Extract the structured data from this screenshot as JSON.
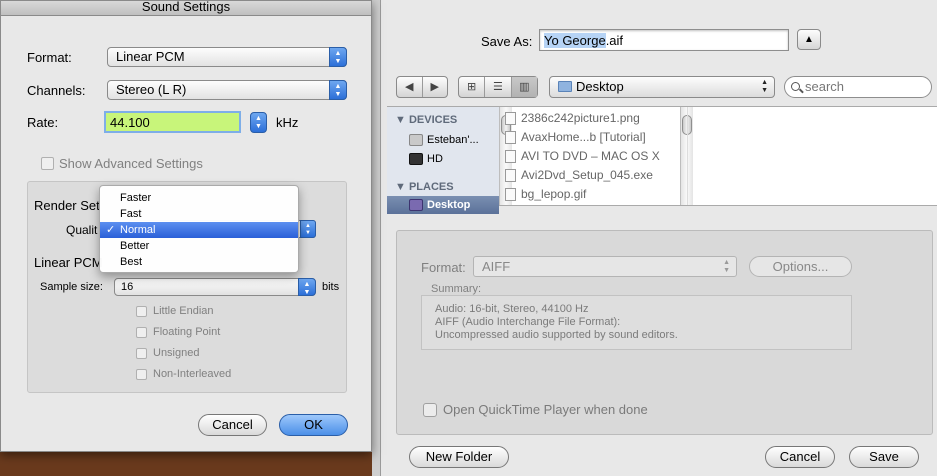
{
  "sound_settings": {
    "title": "Sound Settings",
    "format_label": "Format:",
    "format_value": "Linear PCM",
    "channels_label": "Channels:",
    "channels_value": "Stereo (L R)",
    "rate_label": "Rate:",
    "rate_value": "44.100",
    "rate_unit": "kHz",
    "show_advanced_label": "Show Advanced Settings",
    "render_label": "Render Set",
    "quality_label": "Qualit",
    "linear_pcm_label": "Linear PCM",
    "sample_size_label": "Sample size:",
    "sample_size_value": "16",
    "bits_label": "bits",
    "checkboxes": [
      "Little Endian",
      "Floating Point",
      "Unsigned",
      "Non-Interleaved"
    ],
    "quality_menu": {
      "items": [
        "Faster",
        "Fast",
        "Normal",
        "Better",
        "Best"
      ],
      "selected": "Normal",
      "check": "✓"
    },
    "cancel_label": "Cancel",
    "ok_label": "OK"
  },
  "save_dialog": {
    "save_as_label": "Save As:",
    "filename_selected": "Yo George",
    "filename_ext": ".aif",
    "expand_glyph": "▲",
    "nav_back": "◀",
    "nav_forward": "▶",
    "view_icons": [
      "⊞",
      "☰",
      "▥"
    ],
    "location": "Desktop",
    "search_placeholder": "search",
    "sidebar": {
      "devices_header": "DEVICES",
      "devices": [
        "Esteban'...",
        "HD"
      ],
      "places_header": "PLACES",
      "places": [
        "Desktop"
      ]
    },
    "files": [
      "2386c242picture1.png",
      "AvaxHome...b [Tutorial]",
      "AVI TO DVD – MAC OS X",
      "Avi2Dvd_Setup_045.exe",
      "bg_lepop.gif"
    ],
    "format_label": "Format:",
    "format_value": "AIFF",
    "options_label": "Options...",
    "summary_label": "Summary:",
    "summary_lines": [
      "Audio: 16-bit, Stereo, 44100 Hz",
      "AIFF (Audio Interchange File Format):",
      "Uncompressed audio supported by sound editors."
    ],
    "open_qt_label": "Open QuickTime Player when done",
    "new_folder_label": "New Folder",
    "cancel_label": "Cancel",
    "save_label": "Save"
  },
  "colors": {
    "accent_blue": "#2c6fd8",
    "rate_field_bg": "#c8f57a",
    "selection": "#b6d3f5"
  }
}
